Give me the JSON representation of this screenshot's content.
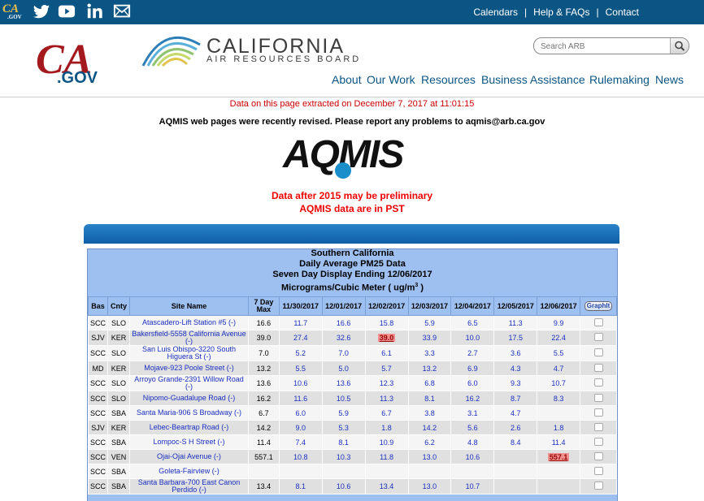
{
  "brand": {
    "cagov_mini": "CA",
    "cagov_mini_sub": ".GOV",
    "cagov_main": "CA",
    "cagov_main_sub": ".GOV",
    "carb_title": "CALIFORNIA",
    "carb_subtitle": "AIR RESOURCES BOARD"
  },
  "top_links": [
    "Calendars",
    "Help & FAQs",
    "Contact"
  ],
  "search": {
    "placeholder": "Search ARB"
  },
  "nav": [
    "About",
    "Our Work",
    "Resources",
    "Business Assistance",
    "Rulemaking",
    "News"
  ],
  "info": {
    "extracted": "Data on this page extracted on December 7, 2017 at 11:01:15",
    "revised": "AQMIS web pages were recently revised. Please report any problems to aqmis@arb.ca.gov",
    "logo_text": "AQMIS",
    "preliminary": "Data after 2015 may be preliminary",
    "pst": "AQMIS data are in PST"
  },
  "table": {
    "title_lines": [
      "Southern California",
      "Daily Average PM25 Data",
      "Seven Day Display Ending 12/06/2017"
    ],
    "units_line": "Micrograms/Cubic Meter ( ug/m",
    "units_sup": "3",
    "units_end": " )",
    "headers": {
      "bas": "Bas",
      "cnty": "Cnty",
      "site": "Site Name",
      "max": "7 Day Max",
      "dates": [
        "11/30/2017",
        "12/01/2017",
        "12/02/2017",
        "12/03/2017",
        "12/04/2017",
        "12/05/2017",
        "12/06/2017"
      ],
      "graph": "GraphIt"
    },
    "rows": [
      {
        "bas": "SCC",
        "cnty": "SLO",
        "site": "Atascadero-Lift Station #5 (-)",
        "max": "16.6",
        "vals": [
          "11.7",
          "16.6",
          "15.8",
          "5.9",
          "6.5",
          "11.3",
          "9.9"
        ],
        "hi": -1
      },
      {
        "bas": "SJV",
        "cnty": "KER",
        "site": "Bakersfield-5558 California Avenue (-)",
        "max": "39.0",
        "vals": [
          "27.4",
          "32.6",
          "39.0",
          "33.9",
          "10.0",
          "17.5",
          "22.4"
        ],
        "hi": 2
      },
      {
        "bas": "SCC",
        "cnty": "SLO",
        "site": "San Luis Obispo-3220 South Higuera St (-)",
        "max": "7.0",
        "vals": [
          "5.2",
          "7.0",
          "6.1",
          "3.3",
          "2.7",
          "3.6",
          "5.5"
        ],
        "hi": -1
      },
      {
        "bas": "MD",
        "cnty": "KER",
        "site": "Mojave-923 Poole Street (-)",
        "max": "13.2",
        "vals": [
          "5.5",
          "5.0",
          "5.7",
          "13.2",
          "6.9",
          "4.3",
          "4.7"
        ],
        "hi": -1
      },
      {
        "bas": "SCC",
        "cnty": "SLO",
        "site": "Arroyo Grande-2391 Willow Road (-)",
        "max": "13.6",
        "vals": [
          "10.6",
          "13.6",
          "12.3",
          "6.8",
          "6.0",
          "9.3",
          "10.7"
        ],
        "hi": -1
      },
      {
        "bas": "SCC",
        "cnty": "SLO",
        "site": "Nipomo-Guadalupe Road (-)",
        "max": "16.2",
        "vals": [
          "11.6",
          "10.5",
          "11.3",
          "8.1",
          "16.2",
          "8.7",
          "8.3"
        ],
        "hi": -1
      },
      {
        "bas": "SCC",
        "cnty": "SBA",
        "site": "Santa Maria-906 S Broadway (-)",
        "max": "6.7",
        "vals": [
          "6.0",
          "5.9",
          "6.7",
          "3.8",
          "3.1",
          "4.7",
          ""
        ],
        "hi": -1
      },
      {
        "bas": "SJV",
        "cnty": "KER",
        "site": "Lebec-Beartrap Road (-)",
        "max": "14.2",
        "vals": [
          "9.0",
          "5.3",
          "1.8",
          "14.2",
          "5.6",
          "2.6",
          "1.8"
        ],
        "hi": -1
      },
      {
        "bas": "SCC",
        "cnty": "SBA",
        "site": "Lompoc-S H Street (-)",
        "max": "11.4",
        "vals": [
          "7.4",
          "8.1",
          "10.9",
          "6.2",
          "4.8",
          "8.4",
          "11.4"
        ],
        "hi": -1
      },
      {
        "bas": "SCC",
        "cnty": "VEN",
        "site": "Ojai-Ojai Avenue (-)",
        "max": "557.1",
        "vals": [
          "10.8",
          "10.3",
          "11.8",
          "13.0",
          "10.6",
          "",
          "557.1"
        ],
        "hi": 6
      },
      {
        "bas": "SCC",
        "cnty": "SBA",
        "site": "Goleta-Fairview (-)",
        "max": "",
        "vals": [
          "",
          "",
          "",
          "",
          "",
          "",
          ""
        ],
        "hi": -1
      },
      {
        "bas": "SCC",
        "cnty": "SBA",
        "site": "Santa Barbara-700 East Canon Perdido (-)",
        "max": "13.4",
        "vals": [
          "8.1",
          "10.6",
          "13.4",
          "13.0",
          "10.7",
          "",
          ""
        ],
        "hi": -1
      }
    ]
  },
  "colors": {
    "topbar": "#0b5585",
    "link": "#1a2fbf",
    "alert": "#e00000",
    "table_bg": "#9ec0f0"
  }
}
